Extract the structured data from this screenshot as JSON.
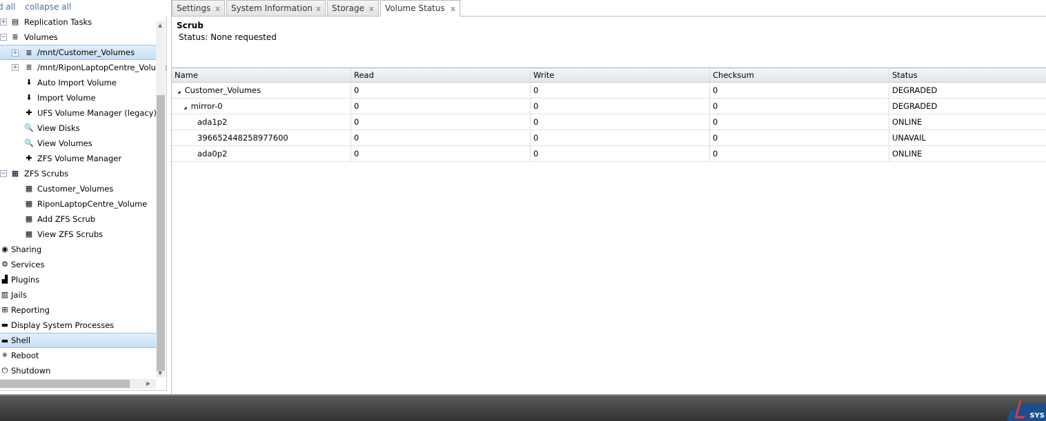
{
  "top_links": {
    "expand": "and all",
    "collapse": "collapse all"
  },
  "tree": [
    {
      "label": "Replication Tasks",
      "level": 1,
      "expander": "+",
      "icon": "▤"
    },
    {
      "label": "Volumes",
      "level": 1,
      "expander": "−",
      "icon": "≣"
    },
    {
      "label": "/mnt/Customer_Volumes",
      "level": 2,
      "expander": "+",
      "icon": "≣",
      "selected": true
    },
    {
      "label": "/mnt/RiponLaptopCentre_Volume",
      "level": 2,
      "expander": "+",
      "icon": "≣"
    },
    {
      "label": "Auto Import Volume",
      "level": 2,
      "icon": "⬇"
    },
    {
      "label": "Import Volume",
      "level": 2,
      "icon": "⬇"
    },
    {
      "label": "UFS Volume Manager (legacy)",
      "level": 2,
      "icon": "✚"
    },
    {
      "label": "View Disks",
      "level": 2,
      "icon": "🔍"
    },
    {
      "label": "View Volumes",
      "level": 2,
      "icon": "🔍"
    },
    {
      "label": "ZFS Volume Manager",
      "level": 2,
      "icon": "✚"
    },
    {
      "label": "ZFS Scrubs",
      "level": 1,
      "expander": "−",
      "icon": "▦"
    },
    {
      "label": "Customer_Volumes",
      "level": 2,
      "icon": "▦"
    },
    {
      "label": "RiponLaptopCentre_Volume",
      "level": 2,
      "icon": "▦"
    },
    {
      "label": "Add ZFS Scrub",
      "level": 2,
      "icon": "▦"
    },
    {
      "label": "View ZFS Scrubs",
      "level": 2,
      "icon": "▦"
    },
    {
      "label": "Sharing",
      "level": 0,
      "icon": "◉"
    },
    {
      "label": "Services",
      "level": 0,
      "icon": "⚙"
    },
    {
      "label": "Plugins",
      "level": 0,
      "icon": "▟"
    },
    {
      "label": "Jails",
      "level": 0,
      "icon": "▥"
    },
    {
      "label": "Reporting",
      "level": 0,
      "icon": "⊞"
    },
    {
      "label": "Display System Processes",
      "level": 0,
      "icon": "▬"
    },
    {
      "label": "Shell",
      "level": 0,
      "icon": "▬",
      "selected": true
    },
    {
      "label": "Reboot",
      "level": 0,
      "icon": "✳"
    },
    {
      "label": "Shutdown",
      "level": 0,
      "icon": "⏻"
    }
  ],
  "tabs": [
    {
      "label": "Settings",
      "close": "x"
    },
    {
      "label": "System Information",
      "close": "x"
    },
    {
      "label": "Storage",
      "close": "x"
    },
    {
      "label": "Volume Status",
      "close": "x",
      "active": true
    }
  ],
  "scrub": {
    "title": "Scrub",
    "status": "Status: None requested"
  },
  "table": {
    "columns": [
      "Name",
      "Read",
      "Write",
      "Checksum",
      "Status"
    ],
    "rows": [
      {
        "indent": 0,
        "toggle": "◢",
        "cells": [
          "Customer_Volumes",
          "0",
          "0",
          "0",
          "DEGRADED"
        ]
      },
      {
        "indent": 1,
        "toggle": "◢",
        "cells": [
          "mirror-0",
          "0",
          "0",
          "0",
          "DEGRADED"
        ]
      },
      {
        "indent": 2,
        "cells": [
          "ada1p2",
          "0",
          "0",
          "0",
          "ONLINE"
        ]
      },
      {
        "indent": 2,
        "cells": [
          "396652448258977600",
          "0",
          "0",
          "0",
          "UNAVAIL"
        ]
      },
      {
        "indent": 2,
        "cells": [
          "ada0p2",
          "0",
          "0",
          "0",
          "ONLINE"
        ]
      }
    ]
  },
  "footer": {
    "logo_text": "SYS"
  }
}
